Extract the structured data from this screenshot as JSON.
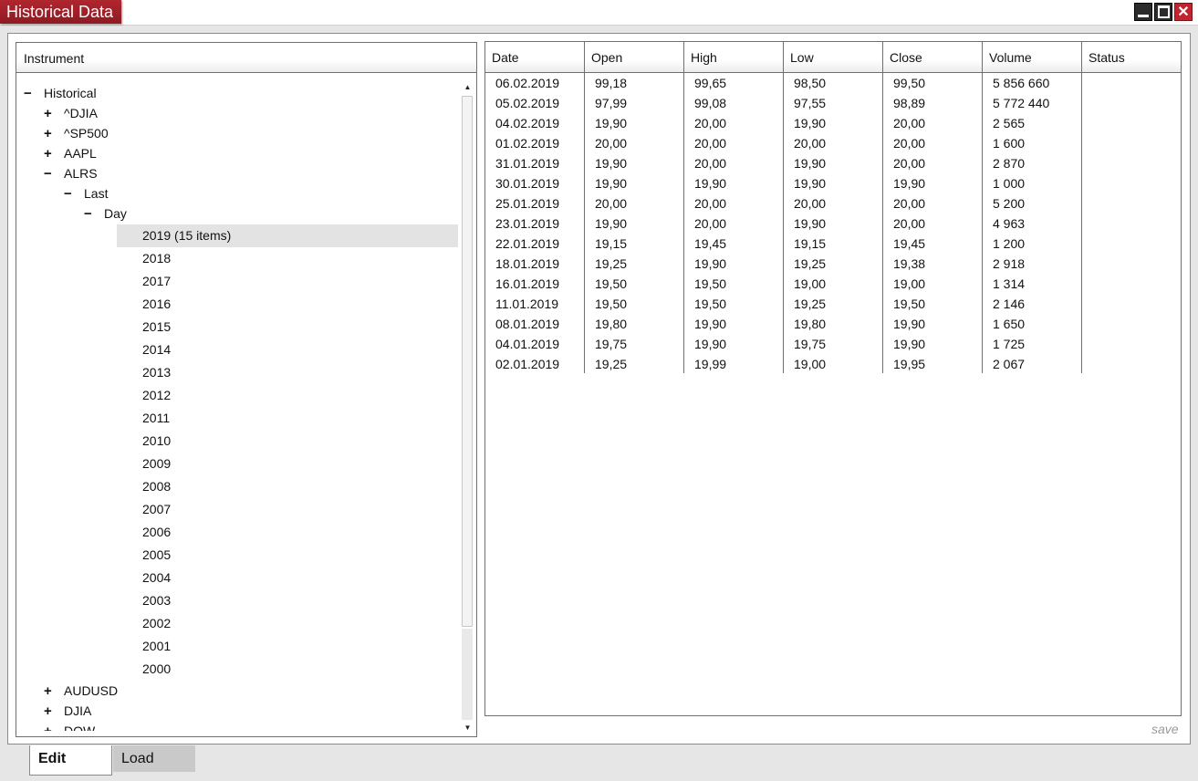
{
  "window": {
    "title": "Historical Data",
    "close_glyph": "✕"
  },
  "tree": {
    "header": "Instrument",
    "nodes": [
      {
        "label": "Historical",
        "toggle": "−",
        "depth": 0
      },
      {
        "label": "^DJIA",
        "toggle": "+",
        "depth": 1
      },
      {
        "label": "^SP500",
        "toggle": "+",
        "depth": 1
      },
      {
        "label": "AAPL",
        "toggle": "+",
        "depth": 1
      },
      {
        "label": "ALRS",
        "toggle": "−",
        "depth": 1
      },
      {
        "label": "Last",
        "toggle": "−",
        "depth": 2
      },
      {
        "label": "Day",
        "toggle": "−",
        "depth": 3
      }
    ],
    "years": [
      "2019 (15 items)",
      "2018",
      "2017",
      "2016",
      "2015",
      "2014",
      "2013",
      "2012",
      "2011",
      "2010",
      "2009",
      "2008",
      "2007",
      "2006",
      "2005",
      "2004",
      "2003",
      "2002",
      "2001",
      "2000"
    ],
    "selected_year_index": 0,
    "after_nodes": [
      {
        "label": "AUDUSD",
        "toggle": "+",
        "depth": 1
      },
      {
        "label": "DJIA",
        "toggle": "+",
        "depth": 1
      },
      {
        "label": "DOW",
        "toggle": "+",
        "depth": 1
      }
    ]
  },
  "grid": {
    "columns": [
      "Date",
      "Open",
      "High",
      "Low",
      "Close",
      "Volume",
      "Status"
    ],
    "rows": [
      [
        "06.02.2019",
        "99,18",
        "99,65",
        "98,50",
        "99,50",
        "5 856 660",
        ""
      ],
      [
        "05.02.2019",
        "97,99",
        "99,08",
        "97,55",
        "98,89",
        "5 772 440",
        ""
      ],
      [
        "04.02.2019",
        "19,90",
        "20,00",
        "19,90",
        "20,00",
        "2 565",
        ""
      ],
      [
        "01.02.2019",
        "20,00",
        "20,00",
        "20,00",
        "20,00",
        "1 600",
        ""
      ],
      [
        "31.01.2019",
        "19,90",
        "20,00",
        "19,90",
        "20,00",
        "2 870",
        ""
      ],
      [
        "30.01.2019",
        "19,90",
        "19,90",
        "19,90",
        "19,90",
        "1 000",
        ""
      ],
      [
        "25.01.2019",
        "20,00",
        "20,00",
        "20,00",
        "20,00",
        "5 200",
        ""
      ],
      [
        "23.01.2019",
        "19,90",
        "20,00",
        "19,90",
        "20,00",
        "4 963",
        ""
      ],
      [
        "22.01.2019",
        "19,15",
        "19,45",
        "19,15",
        "19,45",
        "1 200",
        ""
      ],
      [
        "18.01.2019",
        "19,25",
        "19,90",
        "19,25",
        "19,38",
        "2 918",
        ""
      ],
      [
        "16.01.2019",
        "19,50",
        "19,50",
        "19,00",
        "19,00",
        "1 314",
        ""
      ],
      [
        "11.01.2019",
        "19,50",
        "19,50",
        "19,25",
        "19,50",
        "2 146",
        ""
      ],
      [
        "08.01.2019",
        "19,80",
        "19,90",
        "19,80",
        "19,90",
        "1 650",
        ""
      ],
      [
        "04.01.2019",
        "19,75",
        "19,90",
        "19,75",
        "19,90",
        "1 725",
        ""
      ],
      [
        "02.01.2019",
        "19,25",
        "19,99",
        "19,00",
        "19,95",
        "2 067",
        ""
      ]
    ]
  },
  "footer": {
    "save_label": "save",
    "tabs": [
      {
        "label": "Edit",
        "active": true
      },
      {
        "label": "Load",
        "active": false
      }
    ]
  },
  "colors": {
    "title_accent": "#a3202a",
    "selection": "#e3e3e3"
  }
}
